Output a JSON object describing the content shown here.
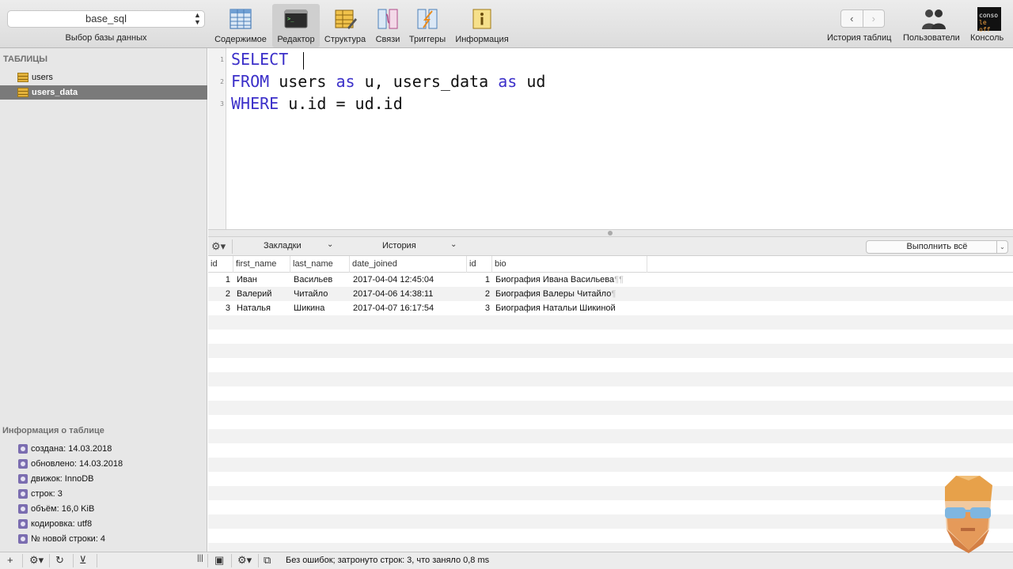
{
  "toolbar": {
    "db_select_value": "base_sql",
    "db_select_caption": "Выбор базы данных",
    "buttons": [
      {
        "label": "Содержимое",
        "icon": "table-content-icon"
      },
      {
        "label": "Редактор",
        "icon": "terminal-icon"
      },
      {
        "label": "Структура",
        "icon": "structure-icon"
      },
      {
        "label": "Связи",
        "icon": "relations-icon"
      },
      {
        "label": "Триггеры",
        "icon": "triggers-icon"
      },
      {
        "label": "Информация",
        "icon": "info-icon"
      }
    ],
    "active_button": "Редактор",
    "history_nav": {
      "back": "‹",
      "forward": "›"
    },
    "history_label": "История таблиц",
    "users_label": "Пользователи",
    "console_label": "Консоль",
    "console_icon_text": [
      "conso",
      "le off"
    ]
  },
  "sidebar": {
    "tables_heading": "ТАБЛИЦЫ",
    "tables": [
      {
        "name": "users",
        "selected": false
      },
      {
        "name": "users_data",
        "selected": true
      }
    ],
    "info_heading": "Информация о таблице",
    "info": [
      "создана: 14.03.2018",
      "обновлено: 14.03.2018",
      "движок: InnoDB",
      "строк: 3",
      "объём: 16,0 KiB",
      "кодировка: utf8",
      "№ новой строки: 4"
    ]
  },
  "editor": {
    "line_numbers": [
      "1",
      "2",
      "3"
    ],
    "lines": [
      [
        {
          "t": "SELECT",
          "kw": true
        },
        {
          "t": " ",
          "kw": false
        }
      ],
      [
        {
          "t": "FROM",
          "kw": true
        },
        {
          "t": " users ",
          "kw": false
        },
        {
          "t": "as",
          "kw": true
        },
        {
          "t": " u, users_data ",
          "kw": false
        },
        {
          "t": "as",
          "kw": true
        },
        {
          "t": " ud",
          "kw": false
        }
      ],
      [
        {
          "t": "WHERE",
          "kw": true
        },
        {
          "t": " u.id = ud.id",
          "kw": false
        }
      ]
    ]
  },
  "querybar": {
    "bookmarks_label": "Закладки",
    "history_label": "История",
    "run_label": "Выполнить всё"
  },
  "results": {
    "columns": [
      "id",
      "first_name",
      "last_name",
      "date_joined",
      "id",
      "bio"
    ],
    "rows": [
      {
        "id": "1",
        "first_name": "Иван",
        "last_name": "Васильев",
        "date_joined": "2017-04-04 12:45:04",
        "id2": "1",
        "bio": "Биография Ивана Васильева",
        "bio_mark": "¶¶"
      },
      {
        "id": "2",
        "first_name": "Валерий",
        "last_name": "Читайло",
        "date_joined": "2017-04-06 14:38:11",
        "id2": "2",
        "bio": "Биография Валеры Читайло",
        "bio_mark": "¶"
      },
      {
        "id": "3",
        "first_name": "Наталья",
        "last_name": "Шикина",
        "date_joined": "2017-04-07 16:17:54",
        "id2": "3",
        "bio": "Биография Натальи Шикиной",
        "bio_mark": ""
      }
    ]
  },
  "statusbar": {
    "message": "Без ошибок; затронуто строк: 3, что заняло 0,8 ms"
  },
  "colors": {
    "keyword": "#3b2fc9",
    "sidebar_bg": "#e7e7e7",
    "selected_row": "#7a7a7a",
    "info_bullet": "#7b6db0"
  }
}
